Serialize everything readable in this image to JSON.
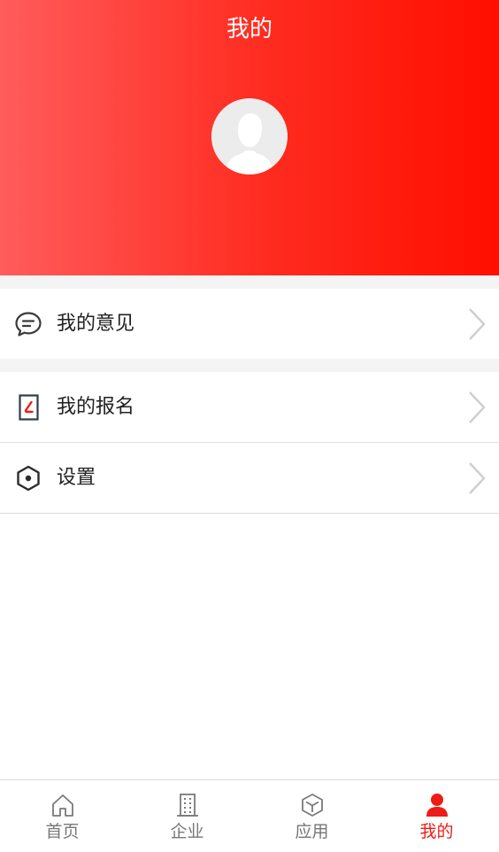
{
  "header": {
    "title": "我的",
    "avatar_icon": "default-user-avatar"
  },
  "menu": {
    "items": [
      {
        "label": "我的意见",
        "icon": "comment-icon"
      },
      {
        "label": "我的报名",
        "icon": "signup-form-icon"
      },
      {
        "label": "设置",
        "icon": "hexagon-settings-icon"
      }
    ]
  },
  "tabbar": {
    "tabs": [
      {
        "label": "首页",
        "icon": "home-icon",
        "active": false
      },
      {
        "label": "企业",
        "icon": "building-icon",
        "active": false
      },
      {
        "label": "应用",
        "icon": "cube-icon",
        "active": false
      },
      {
        "label": "我的",
        "icon": "user-icon",
        "active": true
      }
    ]
  },
  "colors": {
    "accent": "#ee1c16",
    "header_gradient_start": "#ff5c5c",
    "header_gradient_end": "#ff0f00",
    "inactive_tab": "#777777"
  }
}
